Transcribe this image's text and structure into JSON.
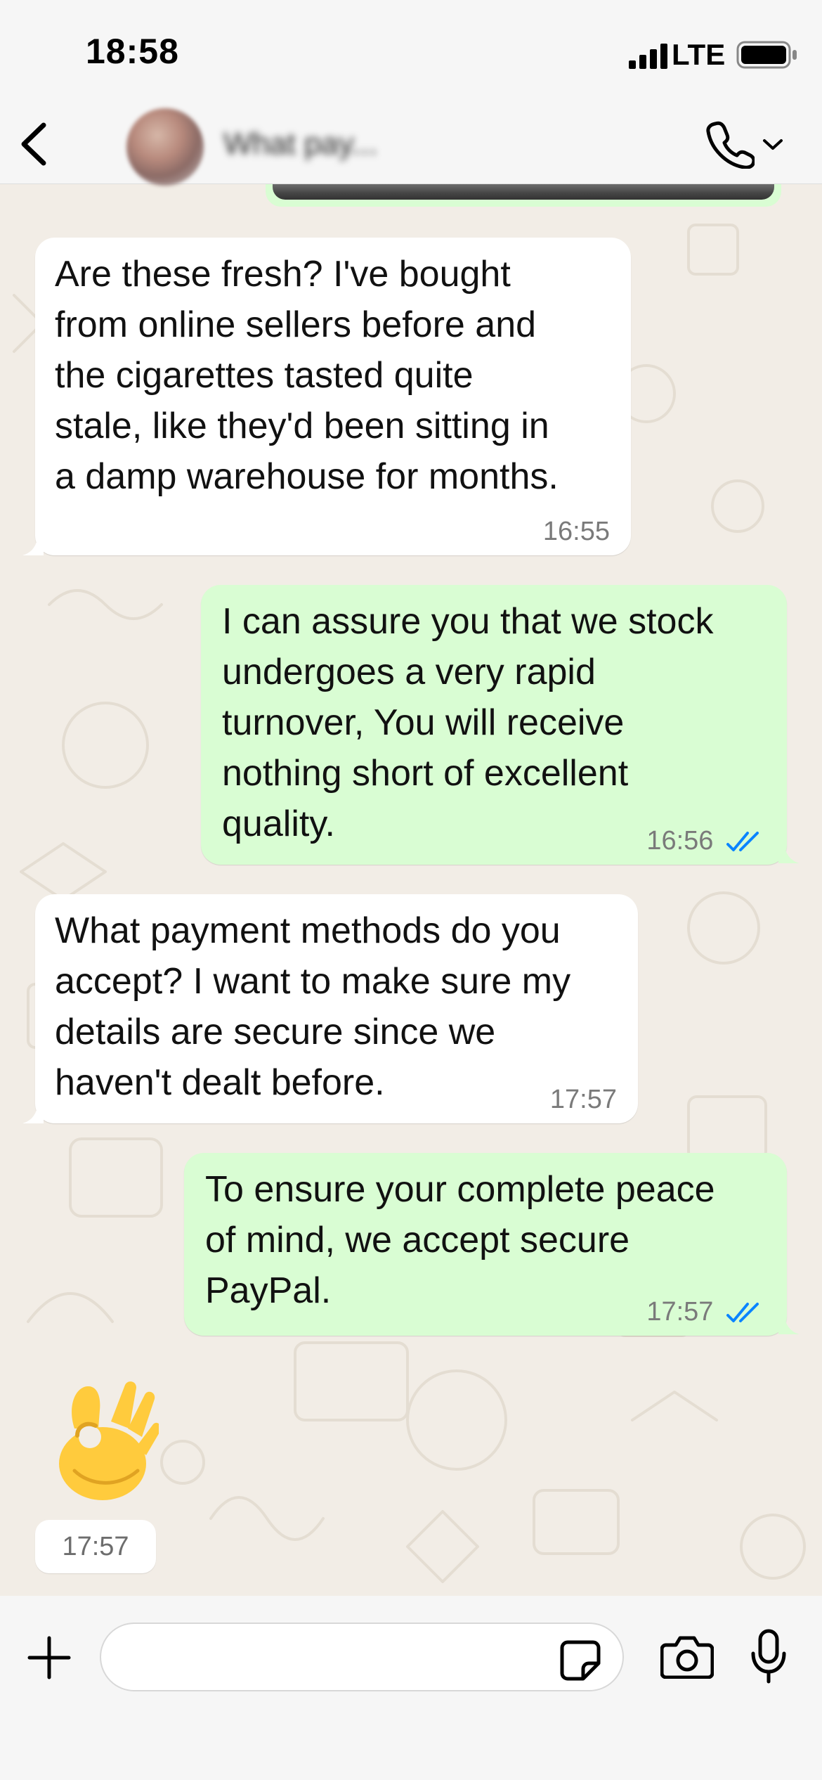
{
  "status_bar": {
    "time": "18:58",
    "network": "LTE"
  },
  "header": {
    "contact_name": "What pay...",
    "icons": {
      "back": "chevron-left-icon",
      "call": "phone-icon",
      "call_menu": "chevron-down-icon"
    }
  },
  "messages": [
    {
      "direction": "in",
      "text": "Are these fresh? I've bought\nfrom online sellers before and\nthe cigarettes tasted quite\nstale, like they'd been sitting in\na damp warehouse for months.",
      "time": "16:55"
    },
    {
      "direction": "out",
      "text": "I can assure you that we stock\nundergoes a very rapid\nturnover, You will receive\nnothing short of excellent\nquality.",
      "time": "16:56",
      "status": "read"
    },
    {
      "direction": "in",
      "text": "What payment methods do you\naccept? I want to make sure my\ndetails are secure since we\nhaven't dealt before.",
      "time": "17:57"
    },
    {
      "direction": "out",
      "text": "To ensure your complete peace\nof mind, we accept secure\nPayPal.",
      "time": "17:57",
      "status": "read"
    },
    {
      "direction": "in",
      "emoji": "👌",
      "time": "17:57"
    }
  ],
  "composer": {
    "placeholder": "",
    "icons": {
      "attach": "plus-icon",
      "sticker": "sticker-icon",
      "camera": "camera-icon",
      "voice": "microphone-icon"
    }
  },
  "colors": {
    "incoming_bubble": "#ffffff",
    "outgoing_bubble": "#d9fdd3",
    "read_ticks": "#0a84ff",
    "chat_background": "#f2ede6"
  }
}
